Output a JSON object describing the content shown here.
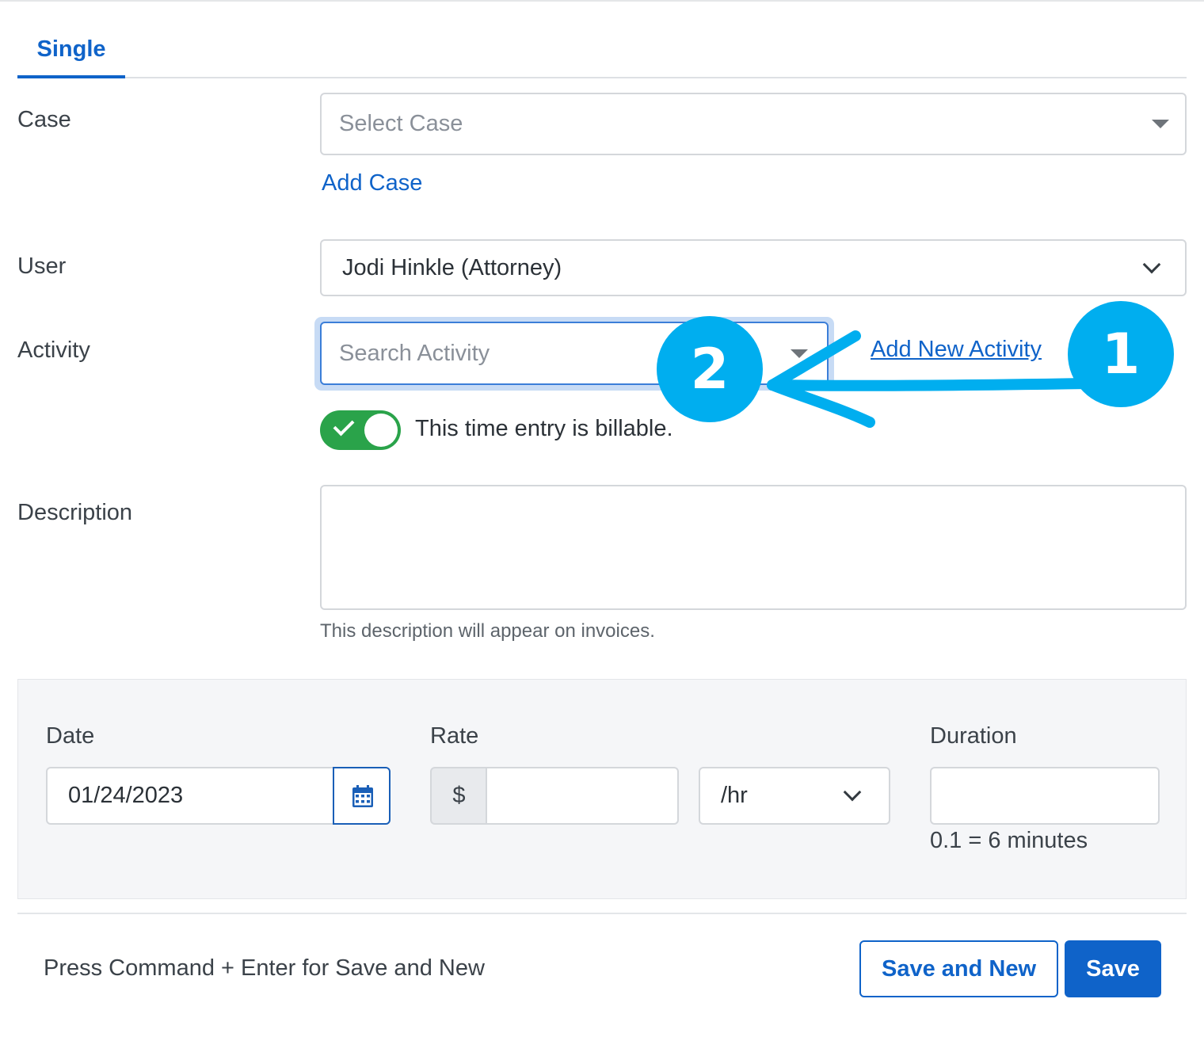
{
  "tabs": [
    {
      "label": "Single",
      "active": true
    }
  ],
  "form": {
    "case": {
      "label": "Case",
      "placeholder": "Select Case",
      "add_link": "Add Case"
    },
    "user": {
      "label": "User",
      "value": "Jodi Hinkle (Attorney)"
    },
    "activity": {
      "label": "Activity",
      "placeholder": "Search Activity",
      "add_link": "Add New Activity"
    },
    "billable": {
      "checked": true,
      "text": "This time entry is billable."
    },
    "description": {
      "label": "Description",
      "value": "",
      "help": "This description will appear on invoices."
    }
  },
  "details": {
    "date": {
      "label": "Date",
      "value": "01/24/2023"
    },
    "rate": {
      "label": "Rate",
      "currency": "$",
      "value": "",
      "unit": "/hr"
    },
    "duration": {
      "label": "Duration",
      "value": "",
      "hint": "0.1 = 6 minutes"
    }
  },
  "footer": {
    "shortcut_hint": "Press Command + Enter for Save and New",
    "save_and_new": "Save and New",
    "save": "Save"
  },
  "annotations": {
    "marker_1": "1",
    "marker_2": "2",
    "color": "#00aeef"
  },
  "colors": {
    "accent": "#0f63c9",
    "toggle_on": "#2aa34a",
    "panel_bg": "#f5f6f8"
  }
}
